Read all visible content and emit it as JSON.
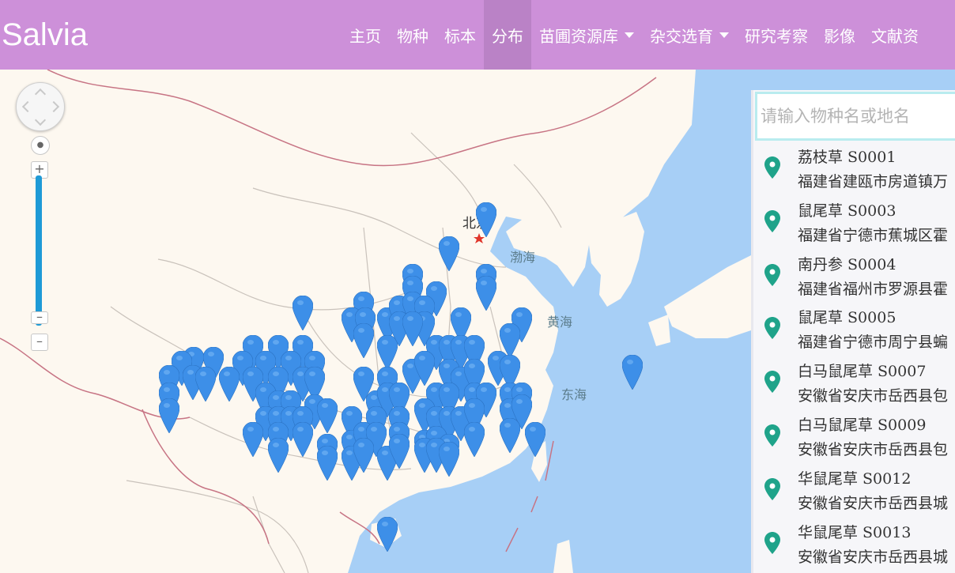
{
  "brand": "Salvia",
  "nav": [
    {
      "label": "主页",
      "active": false,
      "dropdown": false
    },
    {
      "label": "物种",
      "active": false,
      "dropdown": false
    },
    {
      "label": "标本",
      "active": false,
      "dropdown": false
    },
    {
      "label": "分布",
      "active": true,
      "dropdown": false
    },
    {
      "label": "苗圃资源库",
      "active": false,
      "dropdown": true
    },
    {
      "label": "杂交选育",
      "active": false,
      "dropdown": true
    },
    {
      "label": "研究考察",
      "active": false,
      "dropdown": false
    },
    {
      "label": "影像",
      "active": false,
      "dropdown": false
    },
    {
      "label": "文献资",
      "active": false,
      "dropdown": false
    }
  ],
  "colors": {
    "nav": "#cd90d9",
    "nav_active": "#ba82c6",
    "pin": "#3d8fe8",
    "list_marker": "#1fa38a",
    "sea": "#a7cff6",
    "land": "#fdf8f0"
  },
  "map": {
    "labels": {
      "beijing": "北京",
      "bohai": "渤海",
      "huanghai": "黄海",
      "donghai": "东海"
    }
  },
  "search": {
    "placeholder": "请输入物种名或地名"
  },
  "list": [
    {
      "name": "荔枝草 S0001",
      "location": "福建省建瓯市房道镇万"
    },
    {
      "name": "鼠尾草 S0003",
      "location": "福建省宁德市蕉城区霍"
    },
    {
      "name": "南丹参 S0004",
      "location": "福建省福州市罗源县霍"
    },
    {
      "name": "鼠尾草 S0005",
      "location": "福建省宁德市周宁县蝙"
    },
    {
      "name": "白马鼠尾草 S0007",
      "location": "安徽省安庆市岳西县包"
    },
    {
      "name": "白马鼠尾草 S0009",
      "location": "安徽省安庆市岳西县包"
    },
    {
      "name": "华鼠尾草 S0012",
      "location": "安徽省安庆市岳西县城"
    },
    {
      "name": "华鼠尾草 S0013",
      "location": "安徽省安庆市岳西县城"
    }
  ]
}
